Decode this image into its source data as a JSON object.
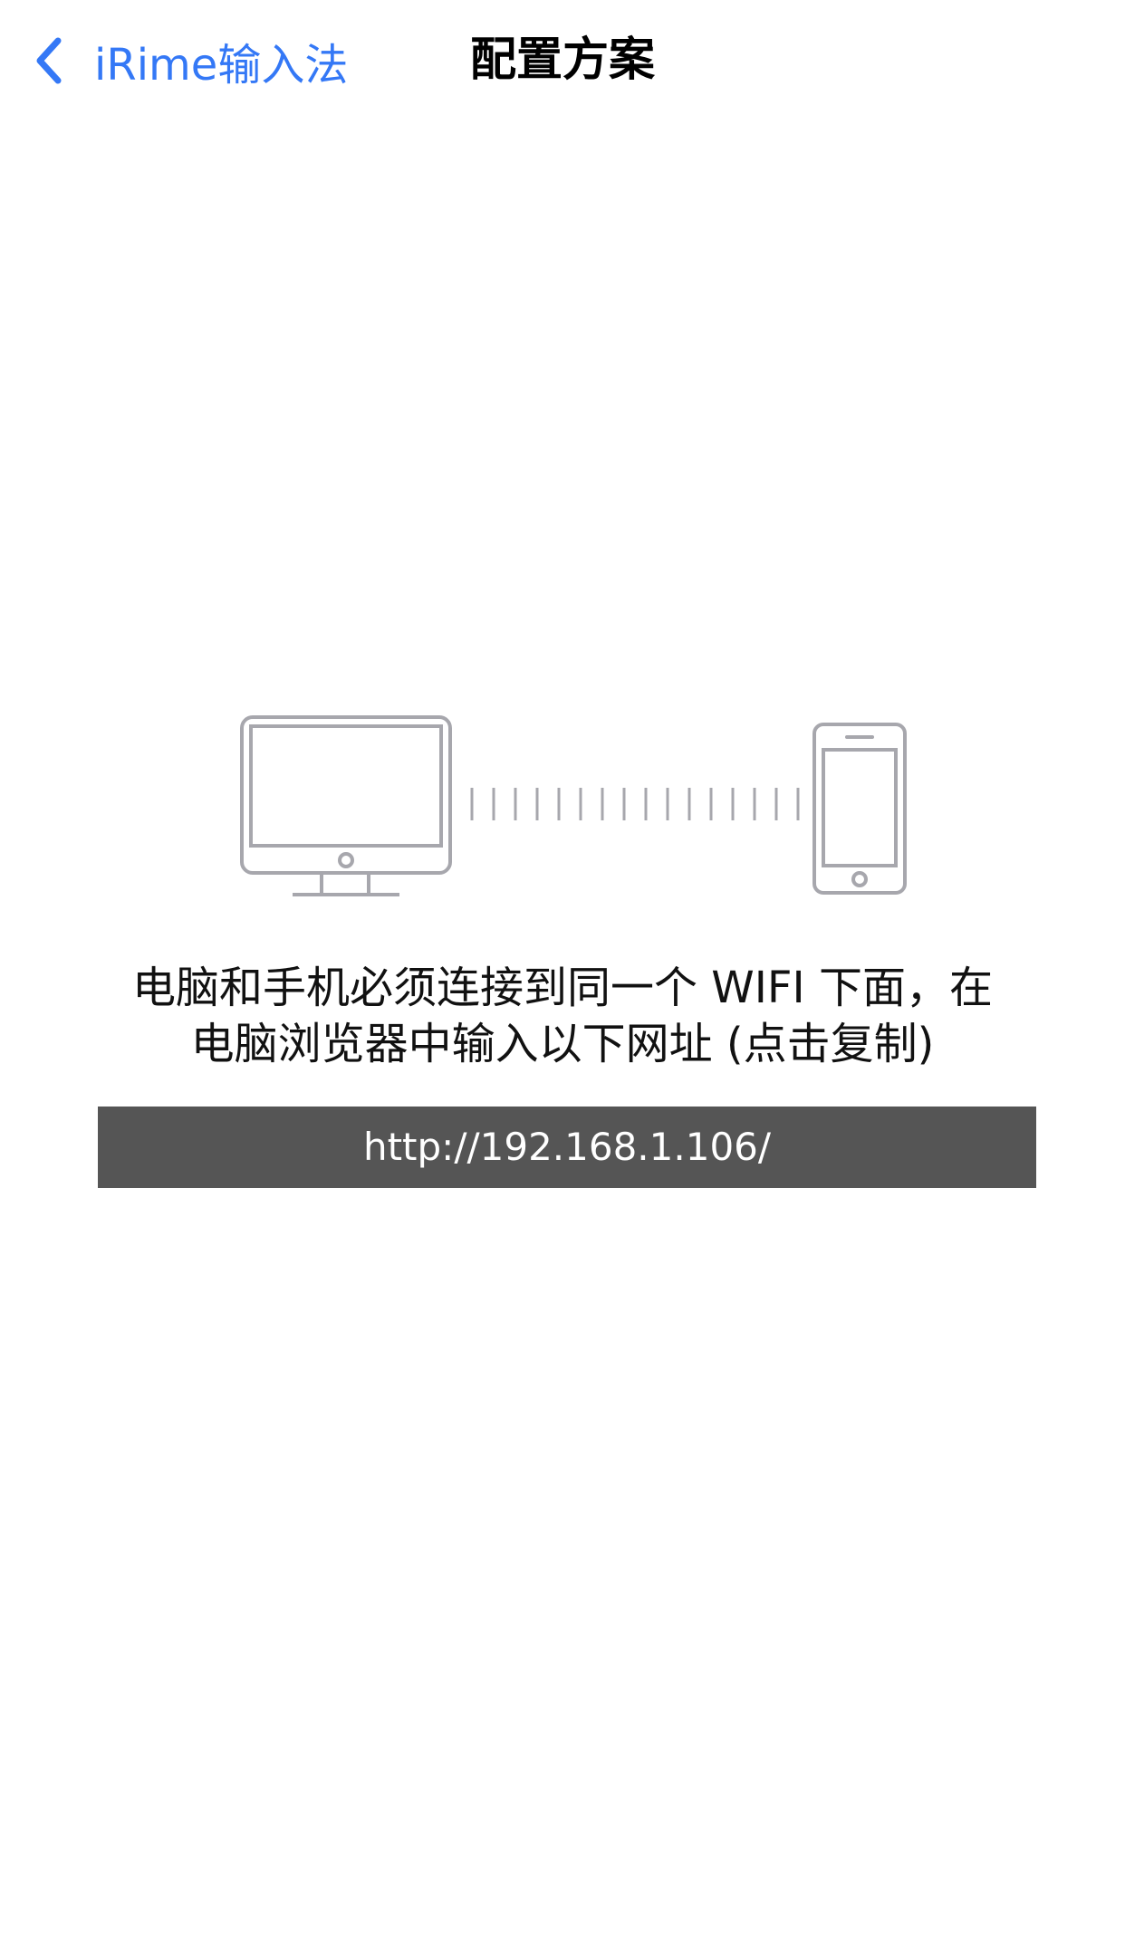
{
  "nav": {
    "back_label": "iRime输入法",
    "title": "配置方案"
  },
  "illustration": {
    "computer_icon": "desktop-monitor-icon",
    "connection_icon": "wifi-connection-dashes",
    "phone_icon": "smartphone-icon",
    "stroke_color": "#a7a7ad"
  },
  "instruction": {
    "line1": "电脑和手机必须连接到同一个 WIFI 下面，在",
    "line2": "电脑浏览器中输入以下网址 (点击复制)"
  },
  "url": {
    "text": "http://192.168.1.106/"
  },
  "colors": {
    "accent": "#3478f6",
    "url_bar_background": "#555555"
  }
}
